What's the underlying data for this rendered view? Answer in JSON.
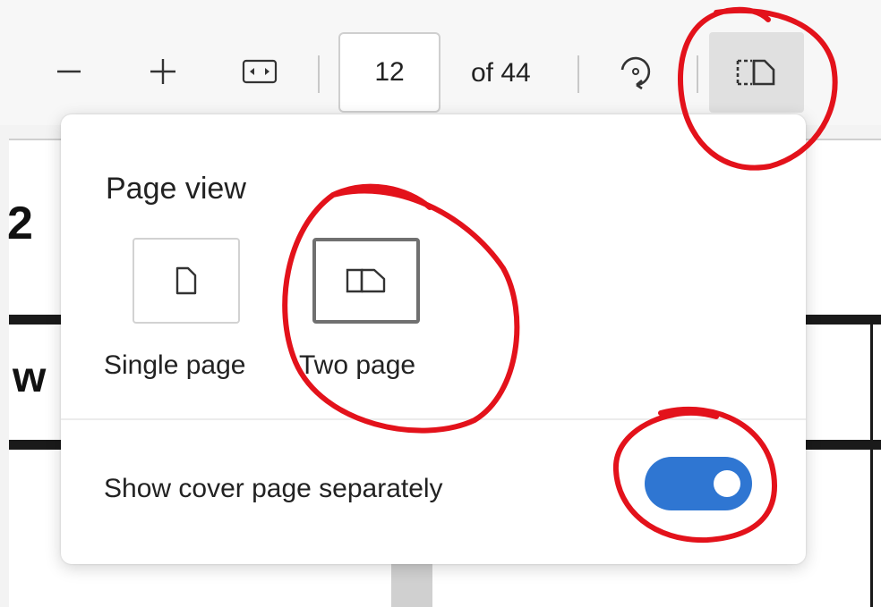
{
  "toolbar": {
    "zoom_out_icon": "minus-icon",
    "zoom_in_icon": "plus-icon",
    "fit_icon": "fit-to-width-icon",
    "current_page": "12",
    "page_count_text": "of 44",
    "rotate_icon": "rotate-icon",
    "page_view_icon": "two-page-view-icon"
  },
  "document": {
    "fragment_1": "2",
    "fragment_2": "w"
  },
  "page_view_menu": {
    "title": "Page view",
    "options": [
      {
        "label": "Single page",
        "icon": "single-page-icon",
        "selected": false
      },
      {
        "label": "Two page",
        "icon": "two-page-icon",
        "selected": true
      }
    ],
    "cover_toggle_label": "Show cover page separately",
    "cover_toggle_on": true
  },
  "colors": {
    "accent": "#2f76d2",
    "annotation": "#e3121b"
  }
}
